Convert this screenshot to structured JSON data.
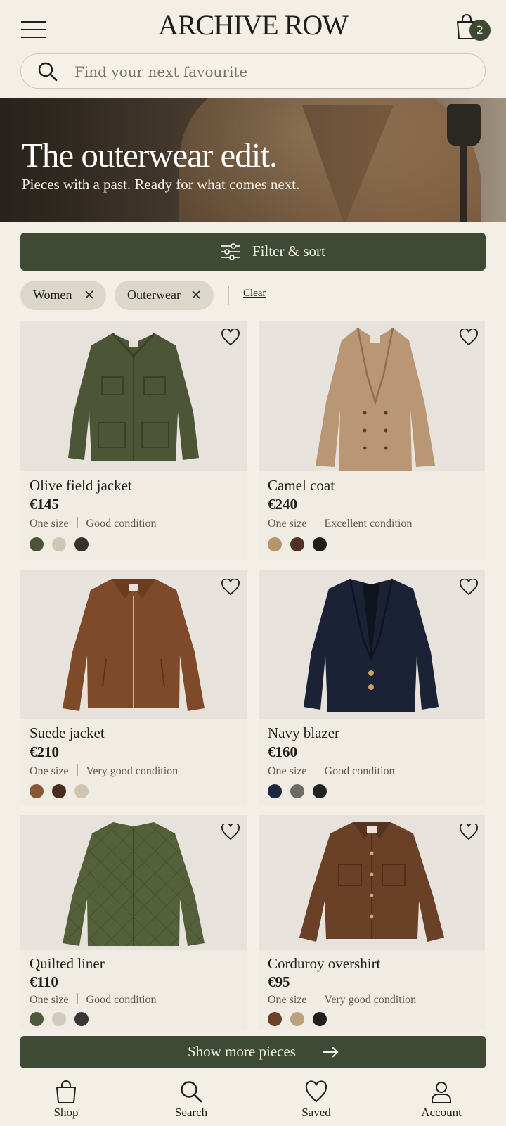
{
  "header": {
    "logo": "ARCHIVE ROW",
    "cart_count": "2",
    "search_placeholder": "Find your next favourite"
  },
  "hero": {
    "title": "The outerwear edit.",
    "subtitle": "Pieces with a past. Ready for what comes next."
  },
  "filters": {
    "button_label": "Filter & sort",
    "chips": [
      "Women",
      "Outerwear"
    ],
    "clear_label": "Clear"
  },
  "products": [
    {
      "name": "Olive field jacket",
      "price": "€145",
      "size": "One size",
      "condition": "Good condition",
      "swatches": [
        "#4b5339",
        "#cfc7b6",
        "#34332f"
      ]
    },
    {
      "name": "Camel coat",
      "price": "€240",
      "size": "One size",
      "condition": "Excellent condition",
      "swatches": [
        "#b7956a",
        "#4d3222",
        "#1f1e1c"
      ]
    },
    {
      "name": "Suede jacket",
      "price": "€210",
      "size": "One size",
      "condition": "Very good condition",
      "swatches": [
        "#8a5634",
        "#4a2d1e",
        "#cfc5b1"
      ]
    },
    {
      "name": "Navy blazer",
      "price": "€160",
      "size": "One size",
      "condition": "Good condition",
      "swatches": [
        "#1c2742",
        "#6d6b67",
        "#222220"
      ]
    },
    {
      "name": "Quilted liner",
      "price": "€110",
      "size": "One size",
      "condition": "Good condition",
      "swatches": [
        "#4f5838",
        "#d2cabc",
        "#383836"
      ]
    },
    {
      "name": "Corduroy overshirt",
      "price": "€95",
      "size": "One size",
      "condition": "Very good condition",
      "swatches": [
        "#6b4128",
        "#b9a27d",
        "#1f1f1d"
      ]
    }
  ],
  "more_button": "Show more pieces",
  "bottom_nav": [
    "Shop",
    "Search",
    "Saved",
    "Account"
  ],
  "colors": {
    "accent": "#3f4a34",
    "background": "#f3efe6"
  }
}
